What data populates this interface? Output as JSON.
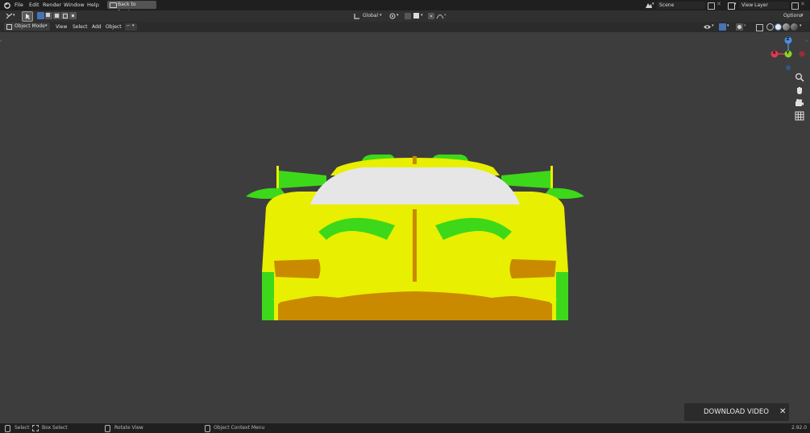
{
  "topbar": {
    "menu": [
      "File",
      "Edit",
      "Render",
      "Window",
      "Help"
    ],
    "back_button": "Back to Previous",
    "scene_label": "Scene",
    "view_layer_label": "View Layer"
  },
  "header": {
    "transform_orientation": "Global",
    "options_label": "Options"
  },
  "viewport_header": {
    "mode": "Object Mode",
    "menus": [
      "View",
      "Select",
      "Add",
      "Object"
    ]
  },
  "gizmo": {
    "axis_z": "Z",
    "axis_y": "Y",
    "axis_x": "X"
  },
  "toast": {
    "label": "DOWNLOAD VIDEO",
    "close": "✕"
  },
  "statusbar": {
    "select": "Select",
    "box_select": "Box Select",
    "rotate_view": "Rotate View",
    "context_menu": "Object Context Menu",
    "version": "2.92.0"
  },
  "colors": {
    "car_body": "#e8ef00",
    "car_green": "#3dd81a",
    "car_orange": "#c98a00",
    "windshield": "#e6e6e6",
    "viewport_bg": "#3d3d3d"
  }
}
